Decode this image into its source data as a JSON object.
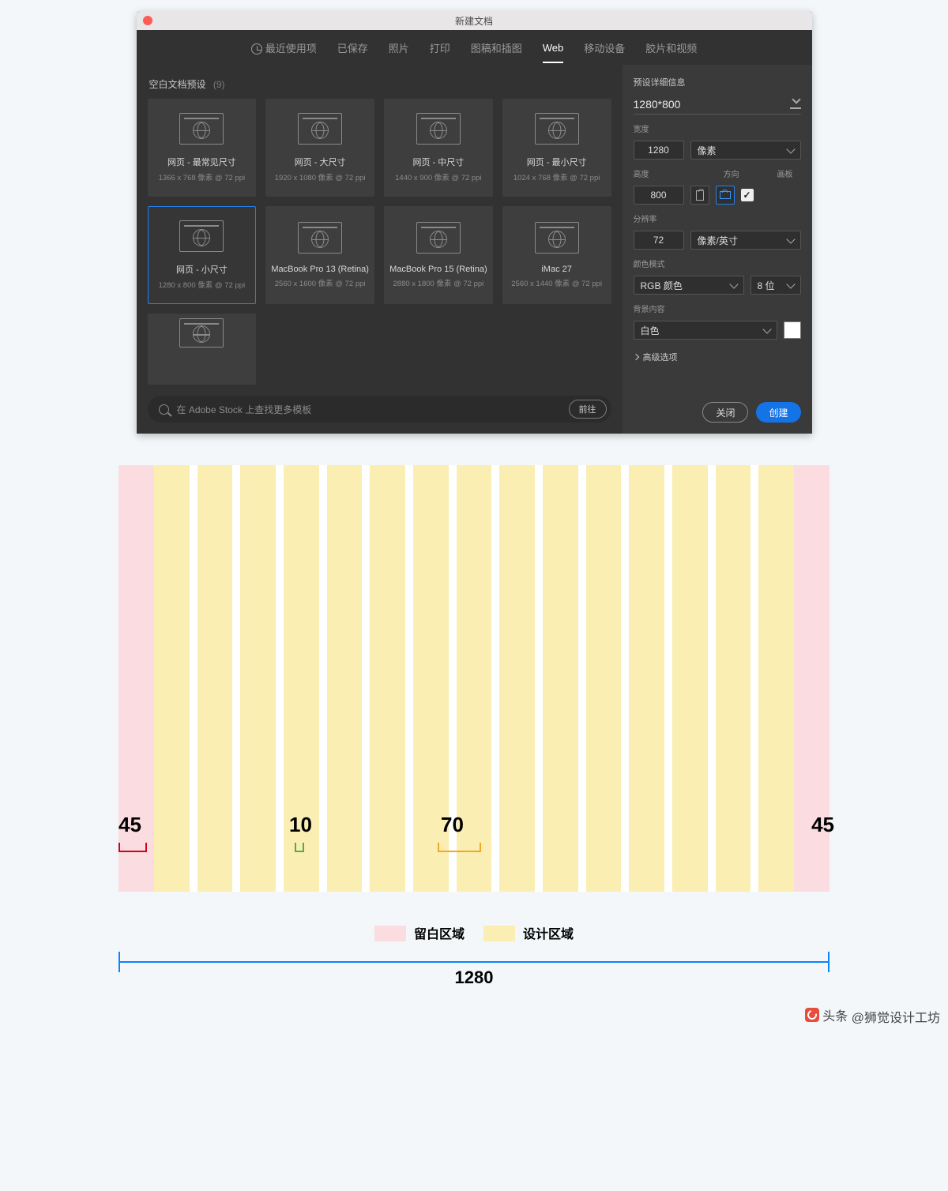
{
  "window": {
    "title": "新建文档"
  },
  "tabs": {
    "recent": "最近使用项",
    "saved": "已保存",
    "photo": "照片",
    "print": "打印",
    "artwork": "图稿和插图",
    "web": "Web",
    "mobile": "移动设备",
    "film": "胶片和视频",
    "active": "web"
  },
  "section": {
    "label": "空白文档预设",
    "count": "(9)"
  },
  "presets": [
    {
      "title": "网页 - 最常见尺寸",
      "sub": "1366 x 768 像素 @ 72 ppi"
    },
    {
      "title": "网页 - 大尺寸",
      "sub": "1920 x 1080 像素 @ 72 ppi"
    },
    {
      "title": "网页 - 中尺寸",
      "sub": "1440 x 900 像素 @ 72 ppi"
    },
    {
      "title": "网页 - 最小尺寸",
      "sub": "1024 x 768 像素 @ 72 ppi"
    },
    {
      "title": "网页 - 小尺寸",
      "sub": "1280 x 800 像素 @ 72 ppi",
      "selected": true
    },
    {
      "title": "MacBook Pro 13 (Retina)",
      "sub": "2560 x 1600 像素 @ 72 ppi"
    },
    {
      "title": "MacBook Pro 15 (Retina)",
      "sub": "2880 x 1800 像素 @ 72 ppi"
    },
    {
      "title": "iMac 27",
      "sub": "2560 x 1440 像素 @ 72 ppi"
    }
  ],
  "search": {
    "placeholder": "在 Adobe Stock 上查找更多模板",
    "go": "前往"
  },
  "details": {
    "heading": "预设详细信息",
    "name": "1280*800",
    "width_label": "宽度",
    "width": "1280",
    "width_unit": "像素",
    "height_label": "高度",
    "height": "800",
    "orient_label": "方向",
    "artboard_label": "画板",
    "res_label": "分辨率",
    "res": "72",
    "res_unit": "像素/英寸",
    "color_label": "颜色模式",
    "color_mode": "RGB 颜色",
    "color_depth": "8 位",
    "bg_label": "背景内容",
    "bg": "白色",
    "advanced": "高级选项"
  },
  "buttons": {
    "close": "关闭",
    "create": "创建"
  },
  "diagram": {
    "margin": "45",
    "gutter": "10",
    "column": "70",
    "legend_margin": "留白区域",
    "legend_design": "设计区域",
    "total": "1280"
  },
  "watermark": {
    "prefix": "头条",
    "handle": "@狮觉设计工坊"
  }
}
